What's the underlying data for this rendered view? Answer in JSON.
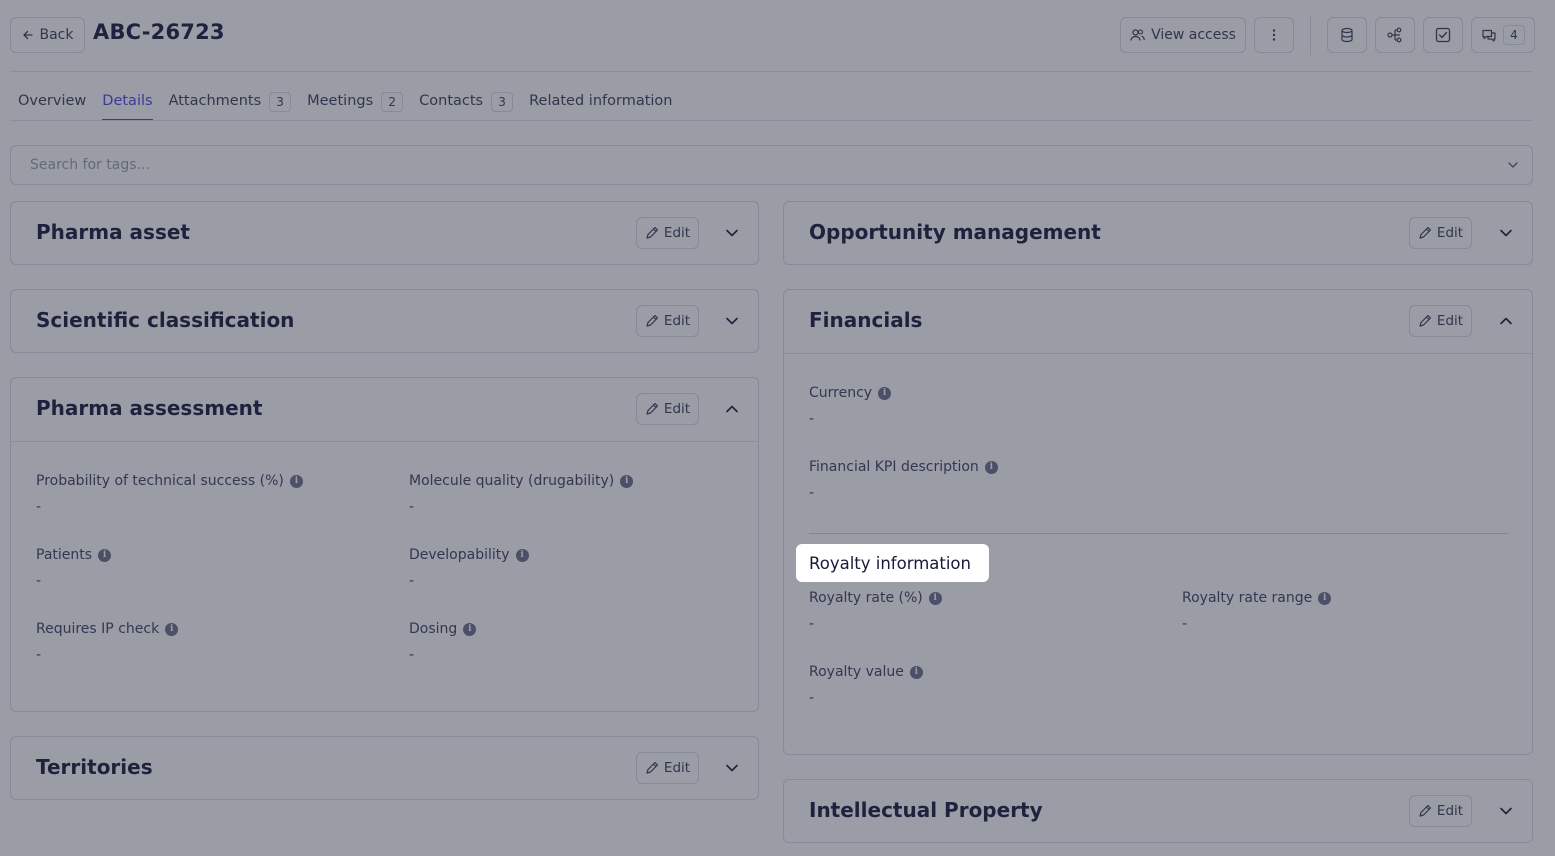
{
  "header": {
    "back_label": "Back",
    "title": "ABC-26723",
    "view_access_label": "View access",
    "comments_count": "4"
  },
  "tabs": [
    {
      "label": "Overview",
      "count": ""
    },
    {
      "label": "Details",
      "count": ""
    },
    {
      "label": "Attachments",
      "count": "3"
    },
    {
      "label": "Meetings",
      "count": "2"
    },
    {
      "label": "Contacts",
      "count": "3"
    },
    {
      "label": "Related information",
      "count": ""
    }
  ],
  "active_tab": "Details",
  "tag_search": {
    "placeholder": "Search for tags..."
  },
  "edit_label": "Edit",
  "left_cards": {
    "pharma_asset": {
      "title": "Pharma asset"
    },
    "scientific_classification": {
      "title": "Scientific classification"
    },
    "pharma_assessment": {
      "title": "Pharma assessment",
      "fields": [
        {
          "label": "Probability of technical success (%)",
          "value": "-"
        },
        {
          "label": "Molecule quality (drugability)",
          "value": "-"
        },
        {
          "label": "Patients",
          "value": "-"
        },
        {
          "label": "Developability",
          "value": "-"
        },
        {
          "label": "Requires IP check",
          "value": "-"
        },
        {
          "label": "Dosing",
          "value": "-"
        }
      ]
    },
    "territories": {
      "title": "Territories"
    }
  },
  "right_cards": {
    "opportunity_management": {
      "title": "Opportunity management"
    },
    "financials": {
      "title": "Financials",
      "fields": [
        {
          "label": "Currency",
          "value": "-"
        },
        {
          "label": "Financial KPI description",
          "value": "-"
        }
      ],
      "royalty": {
        "title": "Royalty information",
        "fields": [
          {
            "label": "Royalty rate (%)",
            "value": "-"
          },
          {
            "label": "Royalty rate range",
            "value": "-"
          },
          {
            "label": "Royalty value",
            "value": "-"
          }
        ]
      }
    },
    "intellectual_property": {
      "title": "Intellectual Property"
    }
  },
  "icons": {
    "back": "arrow-left-icon",
    "view_access": "users-icon",
    "more": "more-vertical-icon",
    "database": "database-icon",
    "graph": "share-nodes-icon",
    "tasks": "checkbox-icon",
    "comments": "comments-icon",
    "edit": "pencil-icon",
    "expand": "chevron-down-icon",
    "collapse": "chevron-up-icon",
    "info": "info-icon"
  },
  "colors": {
    "accent": "#4f46e5",
    "overlay": "rgba(40,44,66,0.47)"
  }
}
